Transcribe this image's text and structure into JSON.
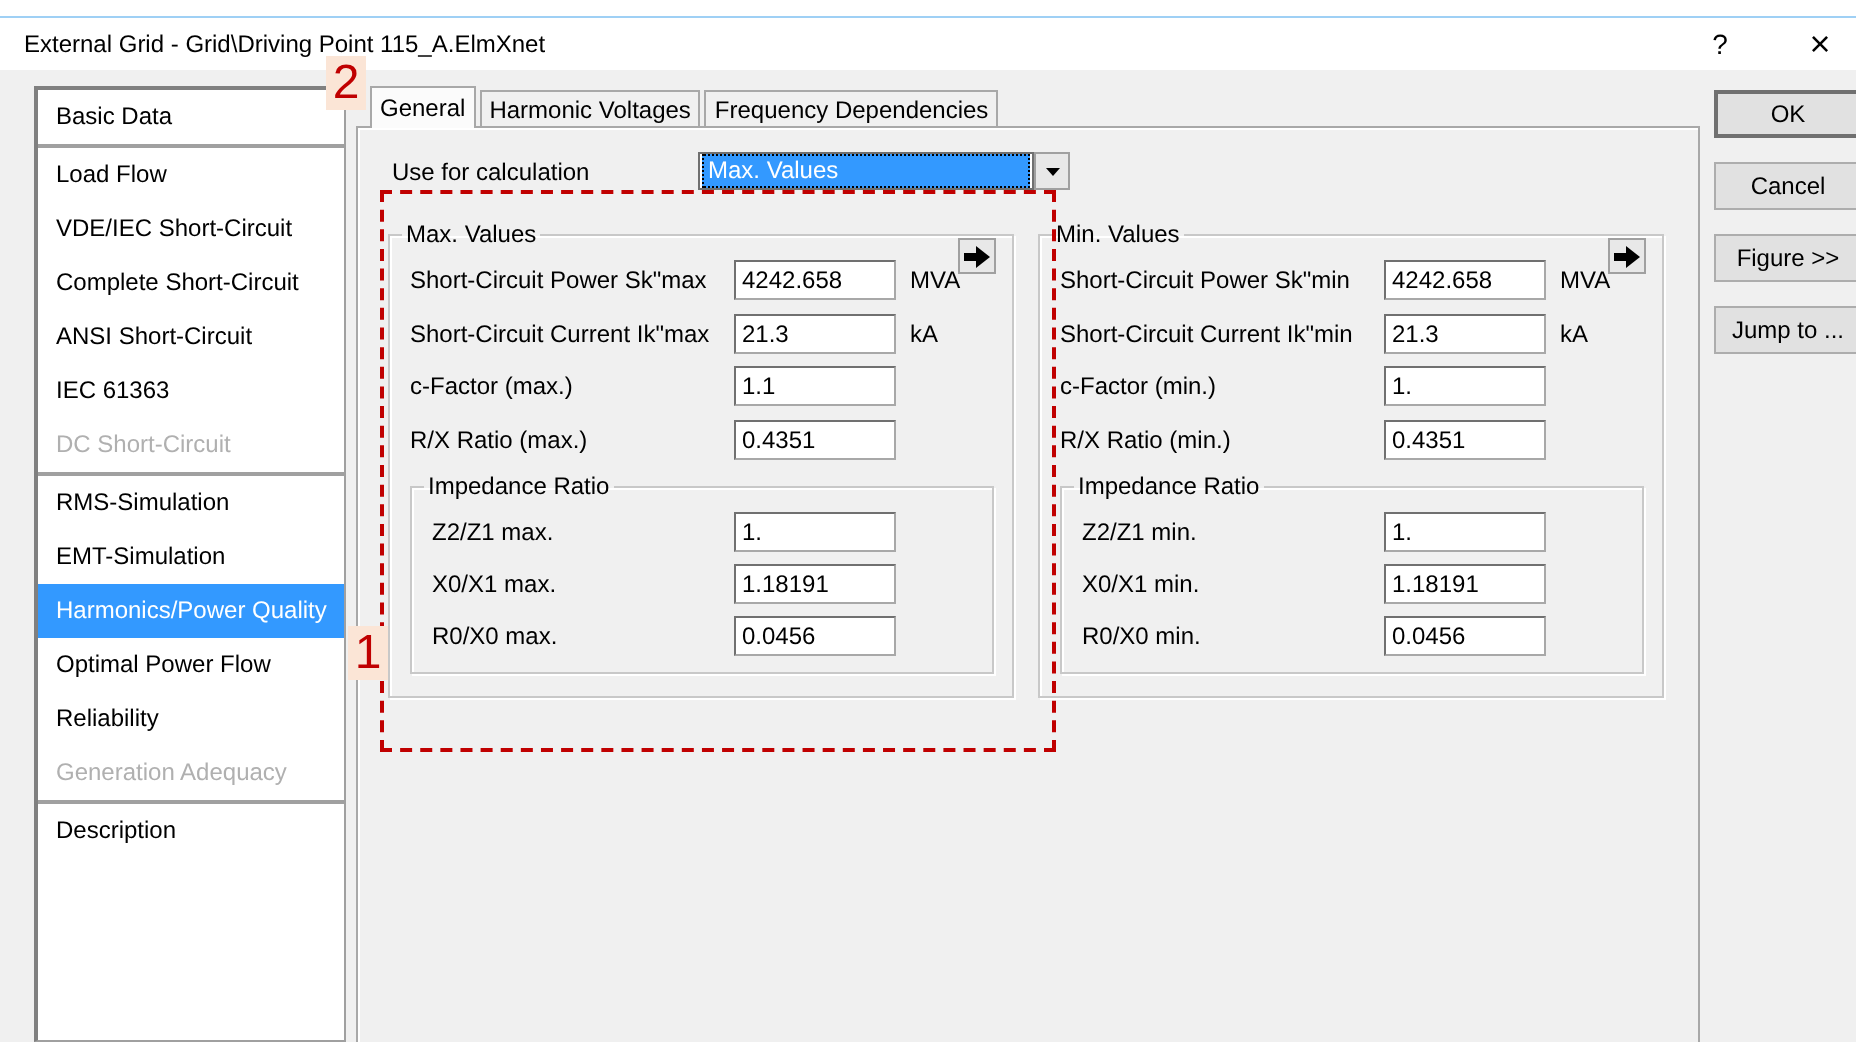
{
  "window": {
    "title": "External Grid - Grid\\Driving Point 115_A.ElmXnet",
    "help": "?",
    "close": "×"
  },
  "sidebar": {
    "groups": [
      {
        "items": [
          {
            "label": "Basic Data",
            "selected": false,
            "disabled": false
          }
        ]
      },
      {
        "items": [
          {
            "label": "Load Flow",
            "selected": false,
            "disabled": false
          },
          {
            "label": "VDE/IEC Short-Circuit",
            "selected": false,
            "disabled": false
          },
          {
            "label": "Complete Short-Circuit",
            "selected": false,
            "disabled": false
          },
          {
            "label": "ANSI Short-Circuit",
            "selected": false,
            "disabled": false
          },
          {
            "label": "IEC 61363",
            "selected": false,
            "disabled": false
          },
          {
            "label": "DC Short-Circuit",
            "selected": false,
            "disabled": true
          }
        ]
      },
      {
        "items": [
          {
            "label": "RMS-Simulation",
            "selected": false,
            "disabled": false
          },
          {
            "label": "EMT-Simulation",
            "selected": false,
            "disabled": false
          },
          {
            "label": "Harmonics/Power Quality",
            "selected": true,
            "disabled": false
          },
          {
            "label": "Optimal Power Flow",
            "selected": false,
            "disabled": false
          },
          {
            "label": "Reliability",
            "selected": false,
            "disabled": false
          },
          {
            "label": "Generation Adequacy",
            "selected": false,
            "disabled": true
          }
        ]
      },
      {
        "items": [
          {
            "label": "Description",
            "selected": false,
            "disabled": false
          }
        ]
      }
    ]
  },
  "tabs": [
    {
      "label": "General",
      "selected": true
    },
    {
      "label": "Harmonic Voltages",
      "selected": false
    },
    {
      "label": "Frequency Dependencies",
      "selected": false
    }
  ],
  "use_for_calculation": {
    "label": "Use for calculation",
    "value": "Max. Values"
  },
  "panels": [
    {
      "title": "Max. Values",
      "rows": [
        {
          "label": "Short-Circuit Power Sk\"max",
          "value": "4242.658",
          "unit": "MVA"
        },
        {
          "label": "Short-Circuit Current Ik\"max",
          "value": "21.3",
          "unit": "kA"
        },
        {
          "label": "c-Factor (max.)",
          "value": "1.1"
        },
        {
          "label": "R/X Ratio (max.)",
          "value": "0.4351"
        }
      ],
      "impedance": {
        "title": "Impedance Ratio",
        "rows": [
          {
            "label": "Z2/Z1 max.",
            "value": "1."
          },
          {
            "label": "X0/X1 max.",
            "value": "1.18191"
          },
          {
            "label": "R0/X0 max.",
            "value": "0.0456"
          }
        ]
      }
    },
    {
      "title": "Min. Values",
      "rows": [
        {
          "label": "Short-Circuit Power Sk\"min",
          "value": "4242.658",
          "unit": "MVA"
        },
        {
          "label": "Short-Circuit Current Ik\"min",
          "value": "21.3",
          "unit": "kA"
        },
        {
          "label": "c-Factor (min.)",
          "value": "1."
        },
        {
          "label": "R/X Ratio (min.)",
          "value": "0.4351"
        }
      ],
      "impedance": {
        "title": "Impedance Ratio",
        "rows": [
          {
            "label": "Z2/Z1 min.",
            "value": "1."
          },
          {
            "label": "X0/X1 min.",
            "value": "1.18191"
          },
          {
            "label": "R0/X0 min.",
            "value": "0.0456"
          }
        ]
      }
    }
  ],
  "buttons": [
    "OK",
    "Cancel",
    "Figure >>",
    "Jump to ..."
  ],
  "annotations": [
    {
      "label": "2"
    },
    {
      "label": "1"
    }
  ]
}
